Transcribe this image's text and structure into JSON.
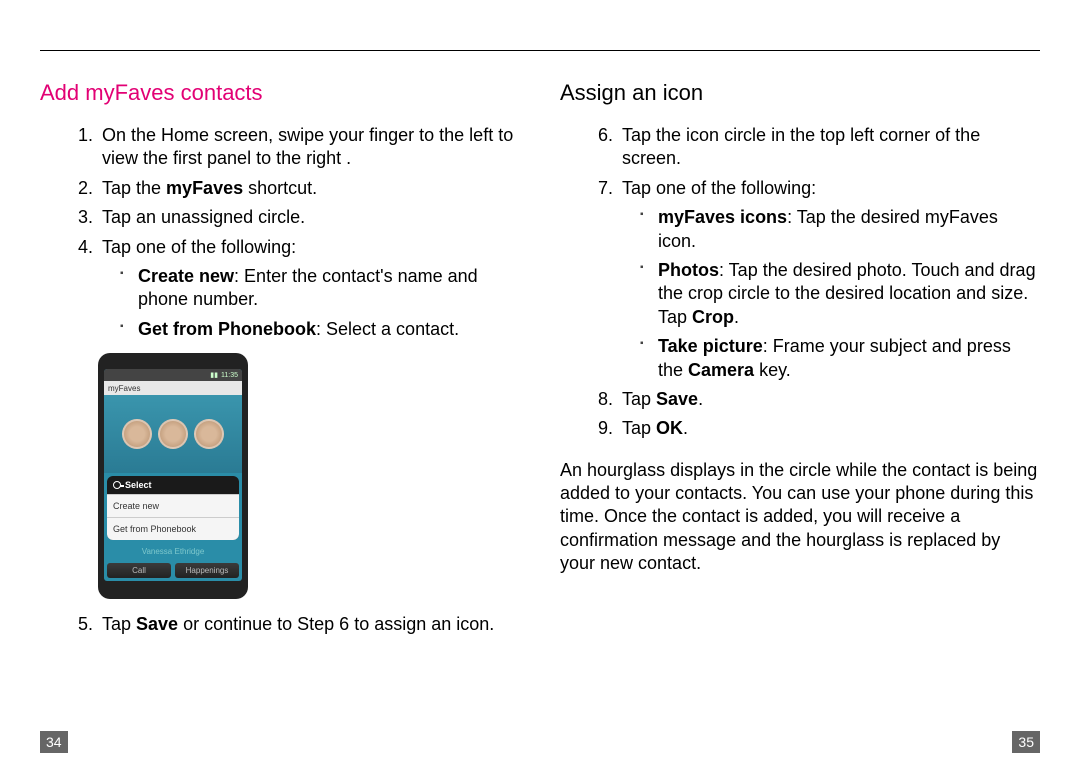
{
  "left": {
    "heading": "Add myFaves contacts",
    "steps": {
      "s1": "On the Home screen, swipe your finger to the left to view the first panel to the right .",
      "s2_pre": "Tap the ",
      "s2_bold": "myFaves",
      "s2_post": " shortcut.",
      "s3": "Tap an unassigned circle.",
      "s4": "Tap one of the following:",
      "s4a_bold": "Create new",
      "s4a_rest": ": Enter the contact's name and phone number.",
      "s4b_bold": "Get from Phonebook",
      "s4b_rest": ": Select a contact.",
      "s5_pre": "Tap ",
      "s5_bold": "Save",
      "s5_post": " or continue to Step 6 to assign an icon."
    },
    "pageno": "34",
    "phone": {
      "time": "11:35",
      "title": "myFaves",
      "select": "Select",
      "row1": "Create new",
      "row2": "Get from Phonebook",
      "name": "Vanessa Ethridge",
      "btn1": "Call",
      "btn2": "Happenings"
    }
  },
  "right": {
    "heading": "Assign an icon",
    "steps": {
      "s6": "Tap the icon circle in the top left corner of the screen.",
      "s7": "Tap one of the following:",
      "s7a_bold": "myFaves icons",
      "s7a_rest": ": Tap the desired myFaves icon.",
      "s7b_bold": "Photos",
      "s7b_rest": ": Tap the desired photo. Touch and drag the crop circle to the desired location and size. Tap ",
      "s7b_bold2": "Crop",
      "s7b_post2": ".",
      "s7c_bold": "Take picture",
      "s7c_rest": ": Frame your subject and press the ",
      "s7c_bold2": "Camera",
      "s7c_post2": " key.",
      "s8_pre": "Tap ",
      "s8_bold": "Save",
      "s8_post": ".",
      "s9_pre": "Tap ",
      "s9_bold": "OK",
      "s9_post": "."
    },
    "paragraph": "An hourglass displays in the circle while the contact is being added to your contacts. You can use your phone during this time. Once the contact is added, you will receive a confirmation message and the hourglass is replaced by your new contact.",
    "pageno": "35"
  }
}
